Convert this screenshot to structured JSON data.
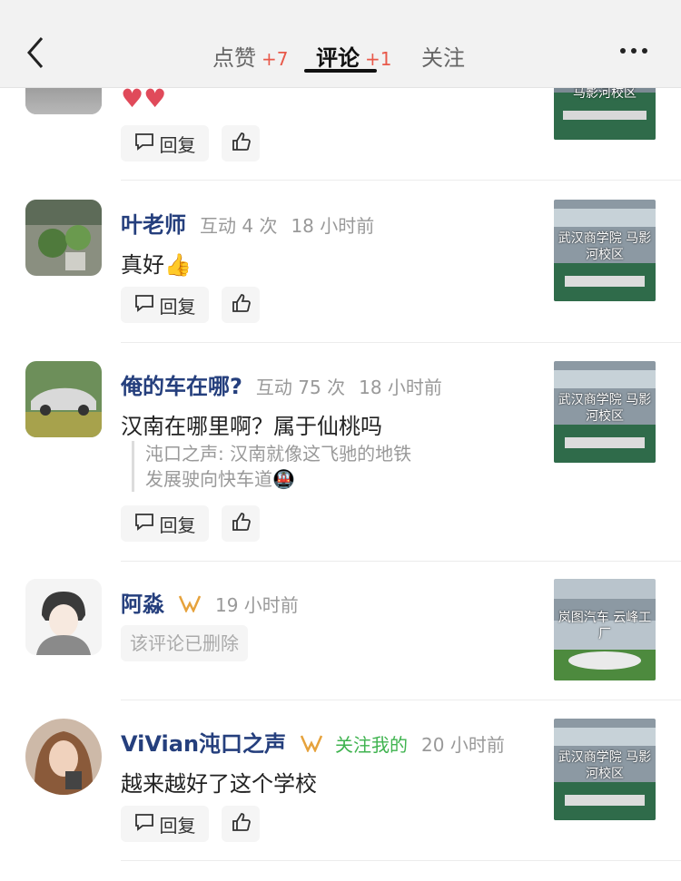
{
  "header": {
    "tabs": [
      {
        "label": "点赞",
        "count": "+7"
      },
      {
        "label": "评论",
        "count": "+1"
      },
      {
        "label": "关注",
        "count": ""
      }
    ]
  },
  "buttons": {
    "reply_label": "回复"
  },
  "comments": [
    {
      "text": "♥♥",
      "thumb_text": "马影河校区"
    },
    {
      "name": "叶老师",
      "interaction": "互动 4 次",
      "time": "18 小时前",
      "text": "真好👍",
      "thumb_text": "武汉商学院 马影河校区"
    },
    {
      "name": "俺的车在哪?",
      "interaction": "互动 75 次",
      "time": "18 小时前",
      "text": "汉南在哪里啊？属于仙桃吗",
      "quote_line1": "沌口之声: 汉南就像这飞驰的地铁",
      "quote_line2": "发展驶向快车道🚇",
      "thumb_text": "武汉商学院 马影河校区"
    },
    {
      "name": "阿淼",
      "time": "19 小时前",
      "deleted": "该评论已删除",
      "thumb_text": "岚图汽车 云峰工厂"
    },
    {
      "name": "ViVian沌口之声",
      "follow": "关注我的",
      "time": "20 小时前",
      "text": "越来越好了这个学校",
      "thumb_text": "武汉商学院 马影河校区"
    }
  ],
  "colors": {
    "name": "#253f7d",
    "count": "#e8594a",
    "follow": "#3fb34f",
    "badge": "#e6a23c"
  }
}
